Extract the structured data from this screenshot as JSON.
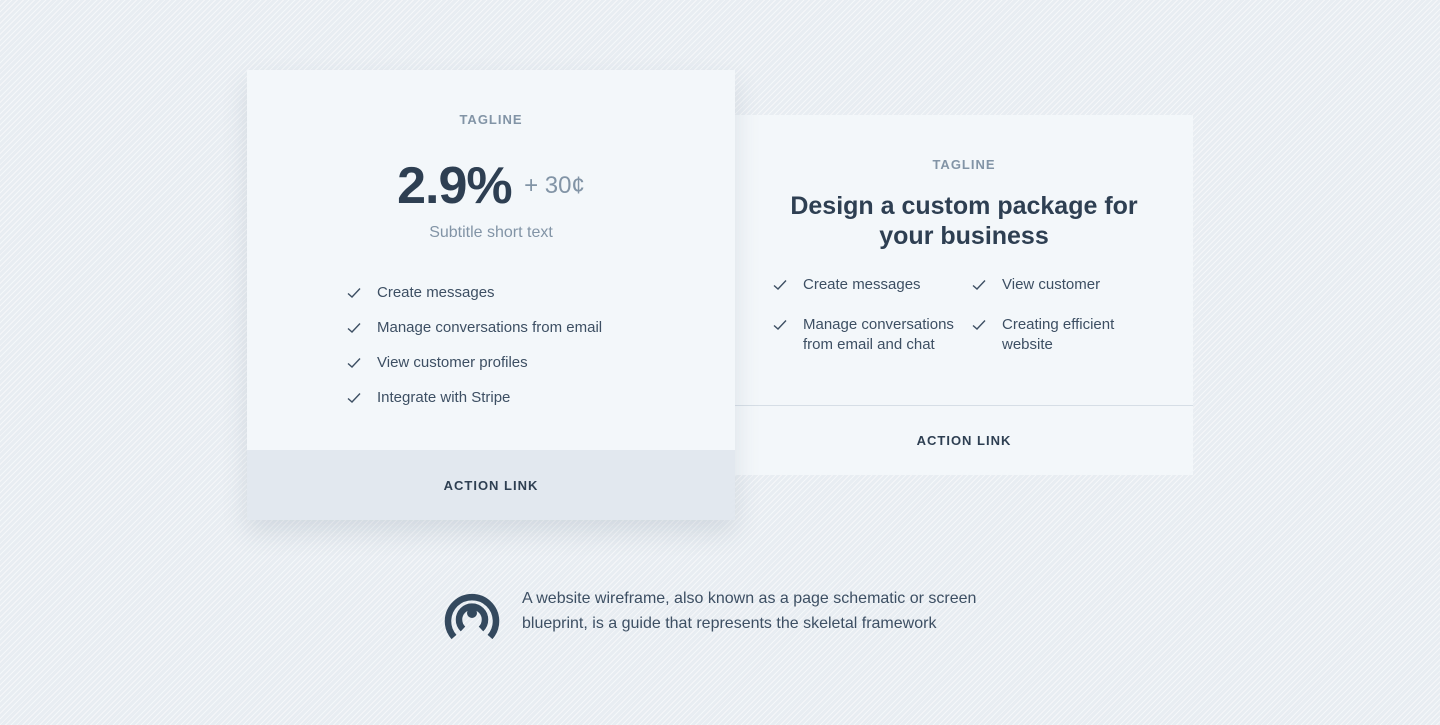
{
  "pricing_card": {
    "tagline": "TAGLINE",
    "price": "2.9%",
    "price_extra": "+ 30¢",
    "subtitle": "Subtitle short text",
    "features": [
      "Create messages",
      "Manage conversations from email",
      "View customer profiles",
      "Integrate with Stripe"
    ],
    "action_label": "ACTION LINK"
  },
  "custom_card": {
    "tagline": "TAGLINE",
    "title": "Design a custom package for your business",
    "features": [
      "Create messages",
      "View customer",
      "Manage conversations from email and chat",
      "Creating efficient website"
    ],
    "action_label": "ACTION LINK"
  },
  "footer": {
    "icon": "broadcast-signal-icon",
    "text": "A website wireframe, also known as a page schematic or screen blueprint, is a guide that represents the skeletal framework"
  },
  "colors": {
    "background": "#e8edf2",
    "card": "#f3f7fa",
    "action_bar": "#e2e8ef",
    "heading": "#2e3f52",
    "muted": "#8294a6"
  }
}
